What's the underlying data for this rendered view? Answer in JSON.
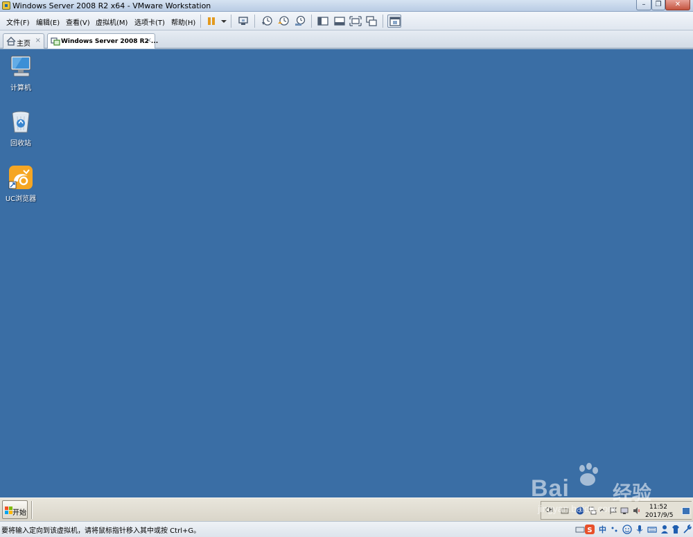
{
  "window": {
    "title": "Windows Server 2008 R2 x64 - VMware Workstation",
    "controls": {
      "minimize_icon": "minimize-icon",
      "maximize_icon": "restore-icon",
      "close_icon": "close-icon"
    }
  },
  "menu": {
    "items": [
      "文件(F)",
      "编辑(E)",
      "查看(V)",
      "虚拟机(M)",
      "选项卡(T)",
      "帮助(H)"
    ]
  },
  "toolbar": {
    "icons": [
      "pause-icon",
      "dropdown-arrow-icon",
      "send-ctrl-alt-del-icon",
      "snapshot-icon",
      "revert-snapshot-icon",
      "snapshot-manager-icon",
      "library-icon",
      "thumbnail-bar-icon",
      "full-screen-icon",
      "unity-icon",
      "console-view-icon"
    ]
  },
  "tabs": [
    {
      "label": "主页",
      "icon": "home-icon",
      "close": "×"
    },
    {
      "label": "Windows Server 2008 R2 ...",
      "icon": "vm-icon",
      "close": "×",
      "active": true
    }
  ],
  "desktop": {
    "background_color": "#3a6ea5",
    "icons": [
      {
        "label": "计算机",
        "icon": "computer-icon"
      },
      {
        "label": "回收站",
        "icon": "recycle-bin-icon"
      },
      {
        "label": "UC浏览器",
        "icon": "uc-browser-icon"
      }
    ]
  },
  "taskbar": {
    "start_label": "开始",
    "tray": {
      "language": "CH",
      "time": "11:52",
      "date": "2017/9/5",
      "icons": [
        "keyboard-icon",
        "help-icon",
        "network-icon",
        "expand-icon",
        "flag-icon",
        "monitor-icon",
        "speaker-icon"
      ]
    }
  },
  "statusbar": {
    "text": "要将输入定向到该虚拟机，请将鼠标指针移入其中或按 Ctrl+G。",
    "ime_label": "中",
    "icons": [
      "sogou-ime-icon",
      "punctuation-icon",
      "emoji-icon",
      "microphone-icon",
      "keyboard-icon",
      "user-icon",
      "skin-icon",
      "wrench-icon"
    ]
  },
  "watermark": {
    "brand": "Bai",
    "brand_cn": "经验",
    "url": "jingyan.baidu.com"
  }
}
